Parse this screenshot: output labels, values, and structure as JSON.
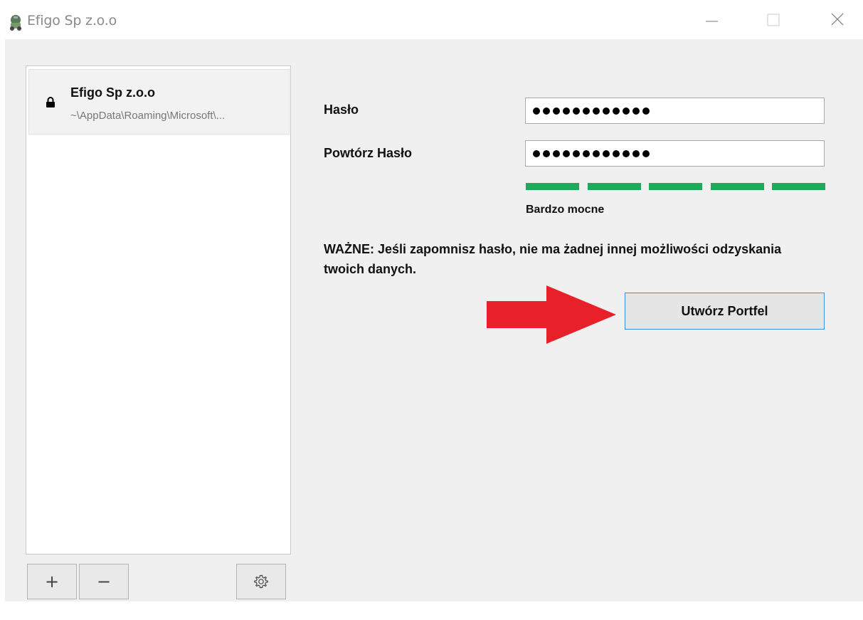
{
  "window": {
    "title": "Efigo Sp z.o.o",
    "controls": {
      "minimize": "—",
      "maximize": "☐",
      "close": "✕"
    }
  },
  "wallets": [
    {
      "name": "Efigo Sp z.o.o",
      "path": "~\\AppData\\Roaming\\Microsoft\\...",
      "icon": "lock-icon"
    }
  ],
  "wallet_actions": {
    "add": "+",
    "remove": "−",
    "settings_icon": "gear-icon"
  },
  "form": {
    "password_label": "Hasło",
    "repeat_label": "Powtórz Hasło",
    "password_mask": "●●●●●●●●●●●●",
    "repeat_mask": "●●●●●●●●●●●●",
    "strength_segments": 5,
    "strength_filled": 5,
    "strength_color": "#22a85a",
    "strength_label": "Bardzo mocne",
    "warning": "WAŻNE: Jeśli zapomnisz hasło, nie ma żadnej innej możliwości odzyskania twoich danych.",
    "create_button": "Utwórz Portfel"
  },
  "annotation": {
    "arrow_color": "#e8202a"
  }
}
